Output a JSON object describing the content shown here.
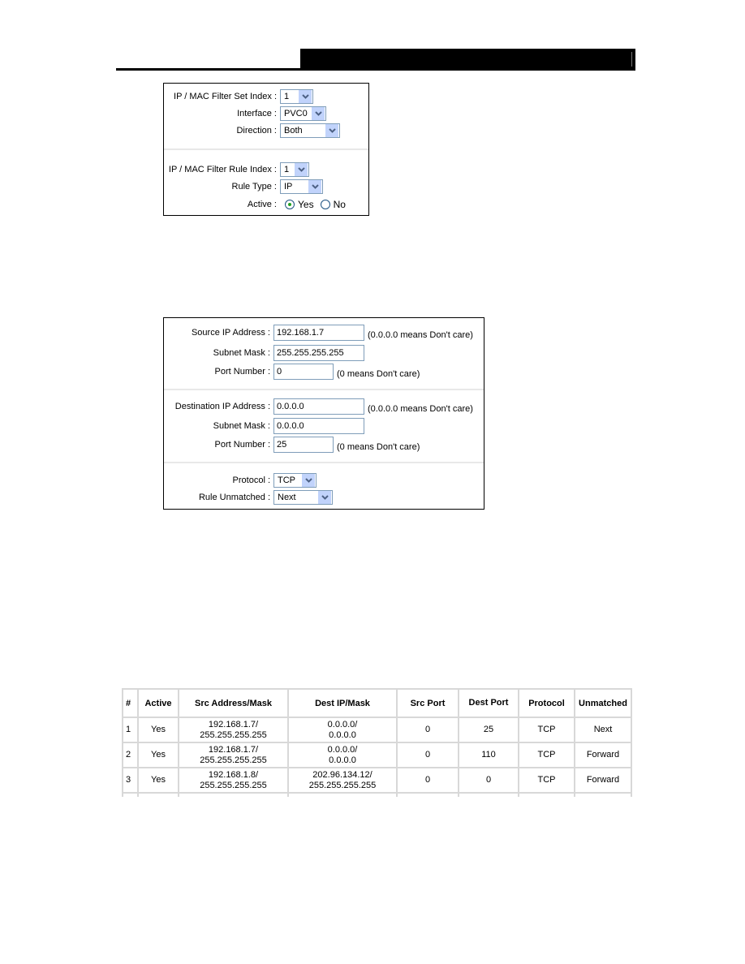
{
  "filter_set_panel": {
    "set_index": {
      "label": "IP / MAC Filter Set Index :",
      "value": "1"
    },
    "interface": {
      "label": "Interface :",
      "value": "PVC0"
    },
    "direction": {
      "label": "Direction :",
      "value": "Both"
    },
    "rule_index": {
      "label": "IP / MAC Filter Rule Index :",
      "value": "1"
    },
    "rule_type": {
      "label": "Rule Type :",
      "value": "IP"
    },
    "active": {
      "label": "Active :",
      "options": [
        "Yes",
        "No"
      ],
      "selected": "Yes"
    }
  },
  "ip_rule_panel": {
    "source_ip": {
      "label": "Source IP Address :",
      "value": "192.168.1.7",
      "hint": "(0.0.0.0 means Don't care)"
    },
    "source_mask": {
      "label": "Subnet Mask :",
      "value": "255.255.255.255"
    },
    "source_port": {
      "label": "Port Number :",
      "value": "0",
      "hint": "(0 means Don't care)"
    },
    "dest_ip": {
      "label": "Destination IP Address :",
      "value": "0.0.0.0",
      "hint": "(0.0.0.0 means Don't care)"
    },
    "dest_mask": {
      "label": "Subnet Mask :",
      "value": "0.0.0.0"
    },
    "dest_port": {
      "label": "Port Number :",
      "value": "25",
      "hint": "(0 means Don't care)"
    },
    "protocol": {
      "label": "Protocol :",
      "value": "TCP"
    },
    "rule_unmatched": {
      "label": "Rule Unmatched :",
      "value": "Next"
    }
  },
  "rules_table": {
    "headers": [
      "#",
      "Active",
      "Src Address/Mask",
      "Dest IP/Mask",
      "Src Port",
      "Dest Port",
      "Protocol",
      "Unmatched"
    ],
    "rows": [
      {
        "num": "1",
        "active": "Yes",
        "src1": "192.168.1.7/",
        "src2": "255.255.255.255",
        "dst1": "0.0.0.0/",
        "dst2": "0.0.0.0",
        "src_port": "0",
        "dest_port": "25",
        "protocol": "TCP",
        "unmatched": "Next"
      },
      {
        "num": "2",
        "active": "Yes",
        "src1": "192.168.1.7/",
        "src2": "255.255.255.255",
        "dst1": "0.0.0.0/",
        "dst2": "0.0.0.0",
        "src_port": "0",
        "dest_port": "110",
        "protocol": "TCP",
        "unmatched": "Forward"
      },
      {
        "num": "3",
        "active": "Yes",
        "src1": "192.168.1.8/",
        "src2": "255.255.255.255",
        "dst1": "202.96.134.12/",
        "dst2": "255.255.255.255",
        "src_port": "0",
        "dest_port": "0",
        "protocol": "TCP",
        "unmatched": "Forward"
      }
    ]
  }
}
